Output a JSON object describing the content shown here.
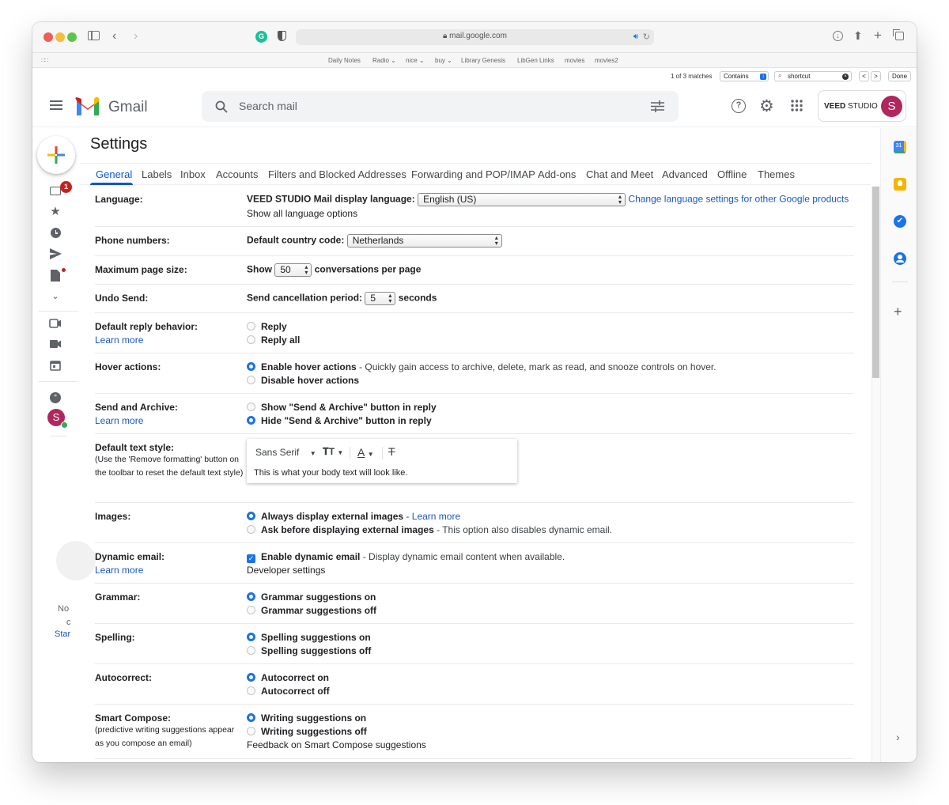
{
  "browser": {
    "url": "mail.google.com",
    "bookmarks": [
      "Daily Notes",
      "Radio",
      "nice",
      "buy",
      "Library Genesis",
      "LibGen Links",
      "movies",
      "movies2"
    ],
    "bookmark_dropdowns": [
      false,
      true,
      true,
      true,
      false,
      false,
      false,
      false
    ],
    "find": {
      "matches": "1 of 3 matches",
      "mode": "Contains",
      "query": "shortcut",
      "prev": "<",
      "next": ">",
      "done": "Done"
    }
  },
  "header": {
    "app_name": "Gmail",
    "search_placeholder": "Search mail",
    "account_brand_bold": "VEED",
    "account_brand_rest": " STUDIO",
    "avatar_letter": "S"
  },
  "nav": {
    "inbox_badge": "1",
    "avatar_letter": "S",
    "side_note_1": "No",
    "side_note_2": "c",
    "side_note_link": "Star"
  },
  "settings": {
    "title": "Settings",
    "tabs": [
      "General",
      "Labels",
      "Inbox",
      "Accounts",
      "Filters and Blocked Addresses",
      "Forwarding and POP/IMAP",
      "Add-ons",
      "Chat and Meet",
      "Advanced",
      "Offline",
      "Themes"
    ],
    "active_tab": "General",
    "language": {
      "label": "Language:",
      "prefix": "VEED STUDIO Mail display language:",
      "selected": "English (US)",
      "link_other": "Change language settings for other Google products",
      "link_all": "Show all language options"
    },
    "phone": {
      "label": "Phone numbers:",
      "prefix": "Default country code:",
      "selected": "Netherlands"
    },
    "page_size": {
      "label": "Maximum page size:",
      "prefix": "Show",
      "selected": "50",
      "suffix": "conversations per page"
    },
    "undo_send": {
      "label": "Undo Send:",
      "prefix": "Send cancellation period:",
      "selected": "5",
      "suffix": "seconds"
    },
    "reply": {
      "label": "Default reply behavior:",
      "learn_more": "Learn more",
      "options": [
        "Reply",
        "Reply all"
      ],
      "selected_index": -1
    },
    "hover": {
      "label": "Hover actions:",
      "option1": "Enable hover actions",
      "option1_desc": " - Quickly gain access to archive, delete, mark as read, and snooze controls on hover.",
      "option2": "Disable hover actions",
      "selected_index": 0
    },
    "send_archive": {
      "label": "Send and Archive:",
      "learn_more": "Learn more",
      "options": [
        "Show \"Send & Archive\" button in reply",
        "Hide \"Send & Archive\" button in reply"
      ],
      "selected_index": 1
    },
    "text_style": {
      "label": "Default text style:",
      "sub": "(Use the 'Remove formatting' button on the toolbar to reset the default text style)",
      "font": "Sans Serif",
      "sample": "This is what your body text will look like."
    },
    "images": {
      "label": "Images:",
      "option1": "Always display external images",
      "option1_link": "Learn more",
      "option2": "Ask before displaying external images",
      "option2_desc": " - This option also disables dynamic email.",
      "selected_index": 0
    },
    "dynamic": {
      "label": "Dynamic email:",
      "learn_more": "Learn more",
      "option": "Enable dynamic email",
      "option_desc": " - Display dynamic email content when available.",
      "checked": true,
      "dev_link": "Developer settings"
    },
    "grammar": {
      "label": "Grammar:",
      "options": [
        "Grammar suggestions on",
        "Grammar suggestions off"
      ],
      "selected_index": 0
    },
    "spelling": {
      "label": "Spelling:",
      "options": [
        "Spelling suggestions on",
        "Spelling suggestions off"
      ],
      "selected_index": 0
    },
    "autocorrect": {
      "label": "Autocorrect:",
      "options": [
        "Autocorrect on",
        "Autocorrect off"
      ],
      "selected_index": 0
    },
    "smart_compose": {
      "label": "Smart Compose:",
      "sub": "(predictive writing suggestions appear as you compose an email)",
      "options": [
        "Writing suggestions on",
        "Writing suggestions off"
      ],
      "selected_index": 0,
      "feedback_link": "Feedback on Smart Compose suggestions"
    }
  },
  "colors": {
    "accent": "#1a73e8",
    "link": "#1a56c4",
    "avatar": "#b1265d",
    "badge": "#c5221f"
  }
}
